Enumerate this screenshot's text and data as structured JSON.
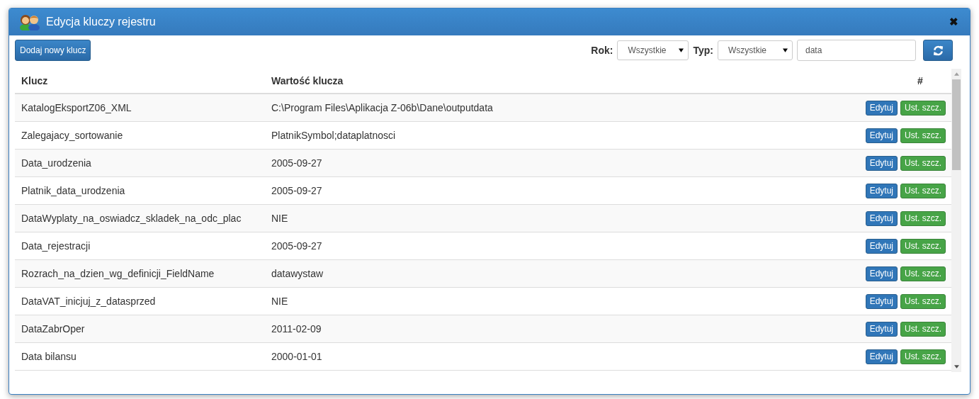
{
  "window": {
    "title": "Edycja kluczy rejestru",
    "close": "✖"
  },
  "toolbar": {
    "add_button": "Dodaj nowy klucz",
    "year_label": "Rok:",
    "year_value": "Wszystkie",
    "type_label": "Typ:",
    "type_value": "Wszystkie",
    "search_value": "data"
  },
  "table": {
    "columns": [
      "Klucz",
      "Wartość klucza",
      "#"
    ],
    "rows": [
      {
        "key": "KatalogEksportZ06_XML",
        "value": "C:\\Program Files\\Aplikacja Z-06b\\Dane\\outputdata",
        "edit": "Edytuj",
        "details": "Ust. szcz."
      },
      {
        "key": "Zalegajacy_sortowanie",
        "value": "PlatnikSymbol;dataplatnosci",
        "edit": "Edytuj",
        "details": "Ust. szcz."
      },
      {
        "key": "Data_urodzenia",
        "value": "2005-09-27",
        "edit": "Edytuj",
        "details": "Ust. szcz."
      },
      {
        "key": "Platnik_data_urodzenia",
        "value": "2005-09-27",
        "edit": "Edytuj",
        "details": "Ust. szcz."
      },
      {
        "key": "DataWyplaty_na_oswiadcz_skladek_na_odc_plac",
        "value": "NIE",
        "edit": "Edytuj",
        "details": "Ust. szcz."
      },
      {
        "key": "Data_rejestracji",
        "value": "2005-09-27",
        "edit": "Edytuj",
        "details": "Ust. szcz."
      },
      {
        "key": "Rozrach_na_dzien_wg_definicji_FieldName",
        "value": "datawystaw",
        "edit": "Edytuj",
        "details": "Ust. szcz."
      },
      {
        "key": "DataVAT_inicjuj_z_datasprzed",
        "value": "NIE",
        "edit": "Edytuj",
        "details": "Ust. szcz."
      },
      {
        "key": "DataZabrOper",
        "value": "2011-02-09",
        "edit": "Edytuj",
        "details": "Ust. szcz."
      },
      {
        "key": "Data bilansu",
        "value": "2000-01-01",
        "edit": "Edytuj",
        "details": "Ust. szcz."
      }
    ]
  }
}
